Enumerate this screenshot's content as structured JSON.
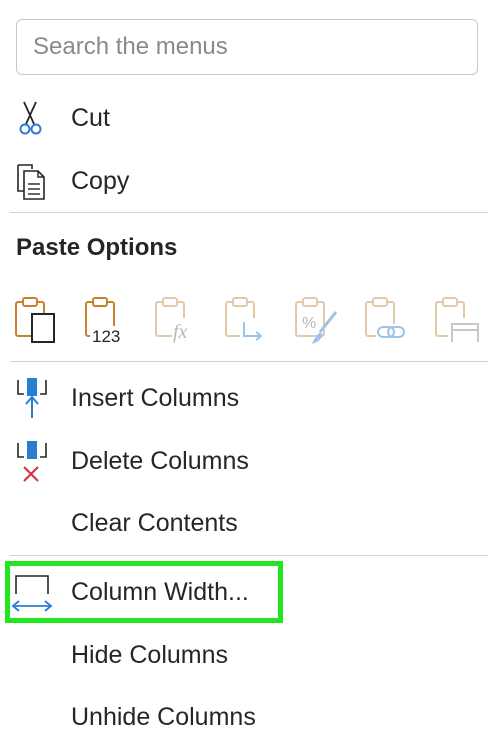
{
  "search": {
    "placeholder": "Search the menus"
  },
  "clipboard": {
    "cut": {
      "label": "Cut",
      "icon": "scissors-icon"
    },
    "copy": {
      "label": "Copy",
      "icon": "copy-icon"
    }
  },
  "paste_options": {
    "heading": "Paste Options",
    "buttons": [
      {
        "icon": "paste-icon",
        "enabled": true
      },
      {
        "icon": "paste-values-icon",
        "enabled": true,
        "badge": "123"
      },
      {
        "icon": "paste-formulas-icon",
        "enabled": false,
        "badge": "fx"
      },
      {
        "icon": "paste-transpose-icon",
        "enabled": false
      },
      {
        "icon": "paste-formatting-icon",
        "enabled": false,
        "badge": "%"
      },
      {
        "icon": "paste-link-icon",
        "enabled": false
      },
      {
        "icon": "paste-column-widths-icon",
        "enabled": false
      }
    ]
  },
  "column_actions": {
    "insert": {
      "label": "Insert Columns",
      "icon": "insert-columns-icon"
    },
    "delete": {
      "label": "Delete Columns",
      "icon": "delete-columns-icon"
    },
    "clear": {
      "label": "Clear Contents"
    }
  },
  "column_format": {
    "width": {
      "label": "Column Width...",
      "icon": "column-width-icon",
      "highlighted": true
    },
    "hide": {
      "label": "Hide Columns"
    },
    "unhide": {
      "label": "Unhide Columns"
    }
  },
  "colors": {
    "accent_blue": "#2b7cd3",
    "accent_orange": "#c9822b",
    "delete_red": "#d13438",
    "highlight_green": "#22e61e",
    "disabled": "#e3c9a8"
  }
}
